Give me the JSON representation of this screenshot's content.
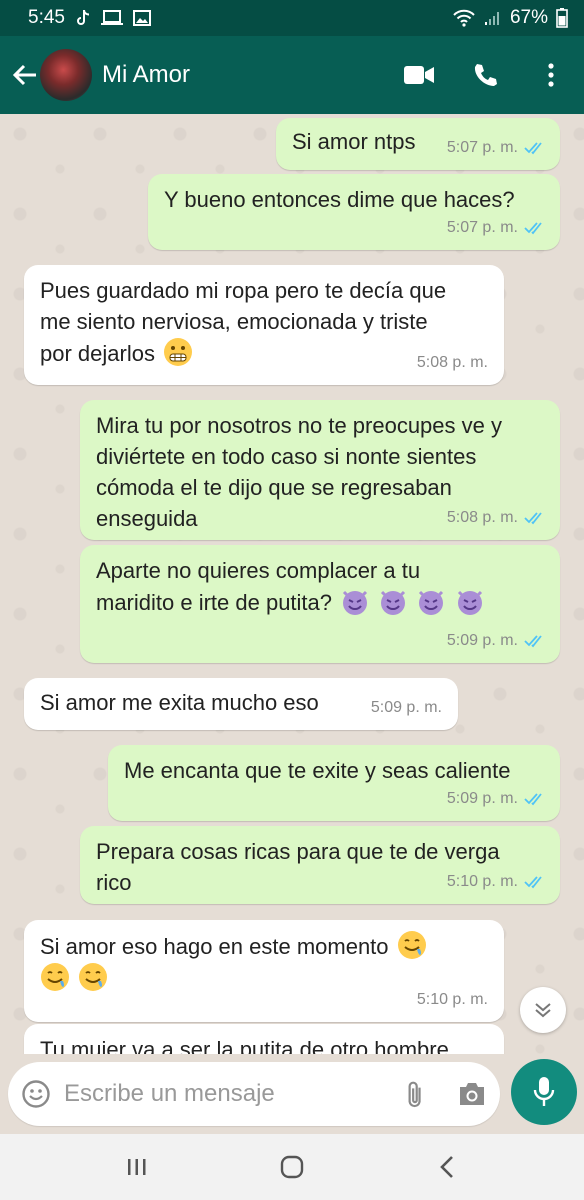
{
  "status_bar": {
    "time": "5:45",
    "battery": "67%"
  },
  "header": {
    "contact_name": "Mi Amor"
  },
  "messages": [
    {
      "dir": "out",
      "text": "Si amor ntps",
      "time": "5:07 p. m.",
      "read": true
    },
    {
      "dir": "out",
      "text": "Y bueno entonces dime que haces?",
      "time": "5:07 p. m.",
      "read": true
    },
    {
      "dir": "in",
      "lines": [
        "Pues guardado mi ropa pero te decía que",
        "me siento nerviosa, emocionada y triste",
        "por dejarlos"
      ],
      "emoji": "grimacing-face",
      "time": "5:08 p. m."
    },
    {
      "dir": "out",
      "lines": [
        "Mira tu por nosotros no te preocupes ve y",
        "diviértete en todo caso si nonte sientes",
        "cómoda el te dijo que se regresaban",
        "enseguida"
      ],
      "time": "5:08 p. m.",
      "read": true
    },
    {
      "dir": "out",
      "lines": [
        "Aparte no quieres complacer a tu",
        "maridito e irte de putita?"
      ],
      "emoji": "smiling-face-with-horns x4",
      "time": "5:09 p. m.",
      "read": true
    },
    {
      "dir": "in",
      "text": "Si amor me exita mucho eso",
      "time": "5:09 p. m."
    },
    {
      "dir": "out",
      "text": "Me encanta que te exite y seas caliente",
      "time": "5:09 p. m.",
      "read": true
    },
    {
      "dir": "out",
      "lines": [
        "Prepara cosas ricas para que te de verga",
        "rico"
      ],
      "time": "5:10 p. m.",
      "read": true
    },
    {
      "dir": "in",
      "text": "Si amor eso hago en este momento",
      "emoji": "drooling-face x3",
      "time": "5:10 p. m."
    },
    {
      "dir": "in",
      "text": "Tu mujer va a ser la putita de otro hombre",
      "partial": true
    }
  ],
  "composer": {
    "placeholder": "Escribe un mensaje"
  },
  "colors": {
    "header": "#075e54",
    "status_bar": "#054d44",
    "outgoing": "#dcf8c6",
    "incoming": "#ffffff",
    "fab": "#128c7e",
    "read_ticks": "#4fc3f7"
  }
}
